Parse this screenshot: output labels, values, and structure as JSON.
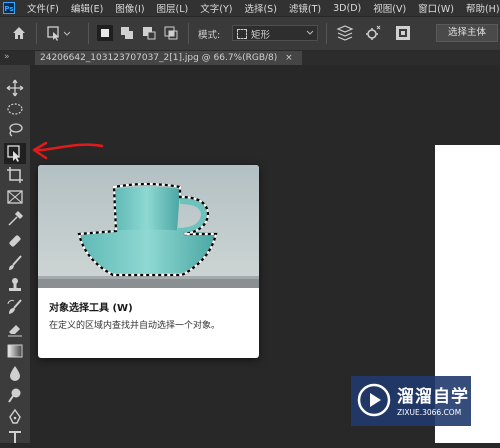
{
  "app": {
    "logo_text": "Ps"
  },
  "menu": [
    "文件(F)",
    "编辑(E)",
    "图像(I)",
    "图层(L)",
    "文字(Y)",
    "选择(S)",
    "滤镜(T)",
    "3D(D)",
    "视图(V)",
    "窗口(W)",
    "帮助(H)"
  ],
  "options_bar": {
    "mode_label": "模式:",
    "mode_value": "矩形",
    "select_subject_label": "选择主体"
  },
  "document_tab": {
    "title": "24206642_103123707037_2[1].jpg @ 66.7%(RGB/8)",
    "close_symbol": "×"
  },
  "tooltip": {
    "title": "对象选择工具 (W)",
    "description": "在定义的区域内查找并自动选择一个对象。"
  },
  "watermark": {
    "name": "溜溜自学",
    "url": "ZIXUE.3066.COM"
  },
  "colors": {
    "menubar": "#323232",
    "optionsbar": "#3a3a3a",
    "toolbar": "#3c3c3c",
    "canvas": "#282828",
    "accent": "#31a8ff",
    "arrow": "#e01b1b"
  }
}
